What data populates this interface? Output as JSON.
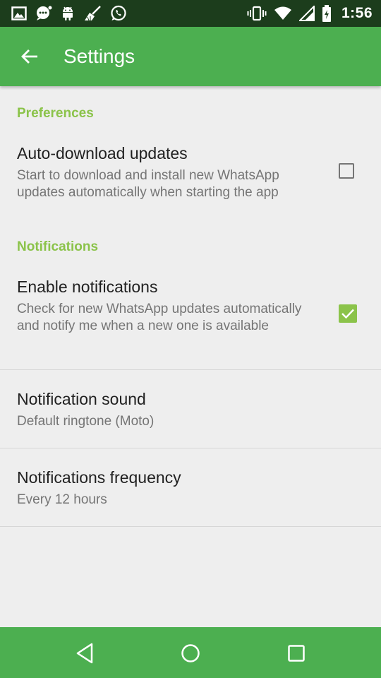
{
  "status_bar": {
    "time": "1:56",
    "left_icons": [
      "gallery-icon",
      "chat-icon",
      "android-icon",
      "broom-icon",
      "whatsapp-icon"
    ],
    "right_icons": [
      "vibrate-icon",
      "wifi-icon",
      "signal-icon",
      "battery-icon"
    ]
  },
  "app_bar": {
    "title": "Settings",
    "color": "#4caf50"
  },
  "sections": {
    "preferences": {
      "header": "Preferences",
      "auto_download": {
        "title": "Auto-download updates",
        "summary": "Start to download and install new WhatsApp updates automatically when starting the app",
        "checked": false
      }
    },
    "notifications": {
      "header": "Notifications",
      "enable": {
        "title": "Enable notifications",
        "summary": "Check for new WhatsApp updates automatically and notify me when a new one is available",
        "checked": true
      },
      "sound": {
        "title": "Notification sound",
        "summary": "Default ringtone (Moto)"
      },
      "frequency": {
        "title": "Notifications frequency",
        "summary": "Every 12 hours"
      }
    }
  },
  "nav_bar": {
    "buttons": [
      "back-triangle-icon",
      "home-circle-icon",
      "recents-square-icon"
    ]
  },
  "colors": {
    "accent": "#8bc34a",
    "primary": "#4caf50",
    "status_bar": "#1c3d1c"
  }
}
